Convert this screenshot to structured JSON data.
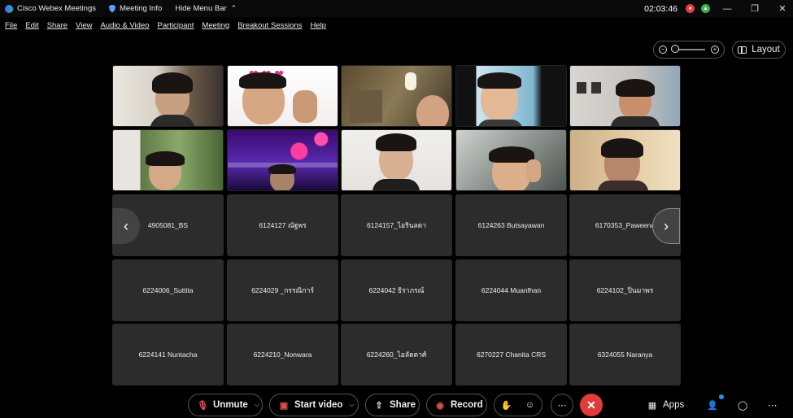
{
  "titlebar": {
    "app_title": "Cisco Webex Meetings",
    "meeting_info": "Meeting Info",
    "hide_menu": "Hide Menu Bar",
    "clock": "02:03:46"
  },
  "menu": [
    "File",
    "Edit",
    "Share",
    "View",
    "Audio & Video",
    "Participant",
    "Meeting",
    "Breakout Sessions",
    "Help"
  ],
  "layout_label": "Layout",
  "participants": [
    "4905081_BS",
    "6124127 ณัฐพร",
    "6124157_ไอรินลดา",
    "6124263 Butsayawan",
    "6170353_Paweena",
    "6224006_Suttita",
    "6224029 _กรรณิการ์",
    "6224042 ธิราภรณ์",
    "6224044 Muanfhan",
    "6224102_ปิ่นมาพร",
    "6224141 Nuntacha",
    "6224210_Nonwara",
    "6224260_ไอลัดดาศ์",
    "6270227 Chanita CRS",
    "6324055 Naranya"
  ],
  "toolbar": {
    "unmute": "Unmute",
    "start_video": "Start video",
    "share": "Share",
    "record": "Record",
    "apps": "Apps"
  },
  "colors": {
    "end_call": "#e23b3b",
    "accent": "#2b8cff",
    "tile_bg": "#2c2c2c"
  },
  "icons": [
    "webex-logo-icon",
    "shield-icon",
    "chevron-up-icon",
    "recording-indicator-icon",
    "minimize-icon",
    "restore-icon",
    "close-icon",
    "zoom-out-icon",
    "zoom-in-icon",
    "grid-layout-icon",
    "mic-muted-icon",
    "video-off-icon",
    "share-icon",
    "record-icon",
    "raise-hand-icon",
    "reactions-icon",
    "more-icon",
    "end-call-icon",
    "apps-icon",
    "participants-icon",
    "chat-icon"
  ]
}
